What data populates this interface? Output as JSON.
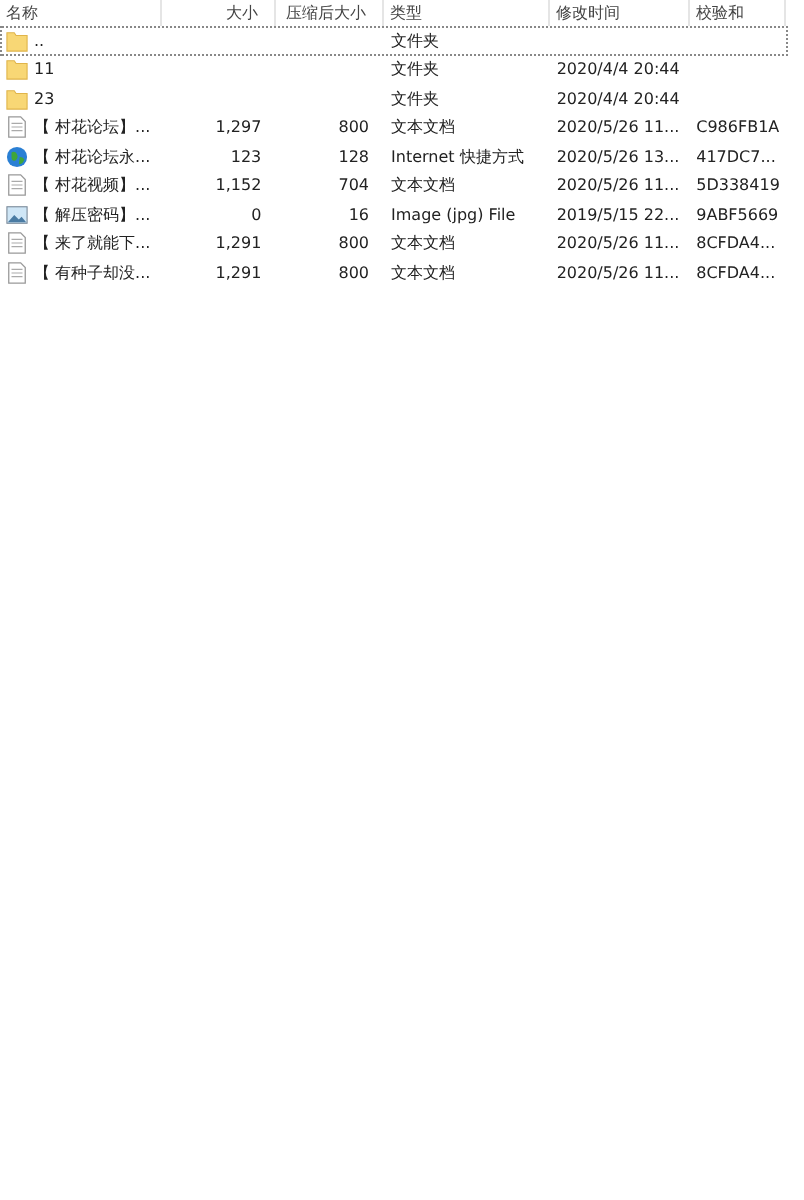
{
  "columns": [
    "名称",
    "大小",
    "压缩后大小",
    "类型",
    "修改时间",
    "校验和"
  ],
  "rows": [
    {
      "kind": "folder",
      "name": "..",
      "type": "文件夹",
      "focused": true
    },
    {
      "kind": "folder",
      "name": "11",
      "type": "文件夹",
      "modified": "2020/4/4 20:44",
      "focused": false
    },
    {
      "kind": "folder",
      "name": "23",
      "type": "文件夹",
      "modified": "2020/4/4 20:44",
      "focused": false
    },
    {
      "kind": "text",
      "name": "【 村花论坛】...",
      "size": "1,297",
      "packed": "800",
      "type": "文本文档",
      "modified": "2020/5/26 11...",
      "checksum": "C986FB1A",
      "focused": false
    },
    {
      "kind": "globe",
      "name": "【 村花论坛永...",
      "size": "123",
      "packed": "128",
      "type": "Internet 快捷方式",
      "modified": "2020/5/26 13...",
      "checksum": "417DC7...",
      "focused": false
    },
    {
      "kind": "text",
      "name": "【 村花视频】...",
      "size": "1,152",
      "packed": "704",
      "type": "文本文档",
      "modified": "2020/5/26 11...",
      "checksum": "5D338419",
      "focused": false
    },
    {
      "kind": "image",
      "name": "【 解压密码】...",
      "size": "0",
      "packed": "16",
      "type": "Image (jpg) File",
      "modified": "2019/5/15 22...",
      "checksum": "9ABF5669",
      "focused": false
    },
    {
      "kind": "text",
      "name": "【 来了就能下...",
      "size": "1,291",
      "packed": "800",
      "type": "文本文档",
      "modified": "2020/5/26 11...",
      "checksum": "8CFDA4...",
      "focused": false
    },
    {
      "kind": "text",
      "name": "【 有种子却没...",
      "size": "1,291",
      "packed": "800",
      "type": "文本文档",
      "modified": "2020/5/26 11...",
      "checksum": "8CFDA4...",
      "focused": false
    }
  ]
}
